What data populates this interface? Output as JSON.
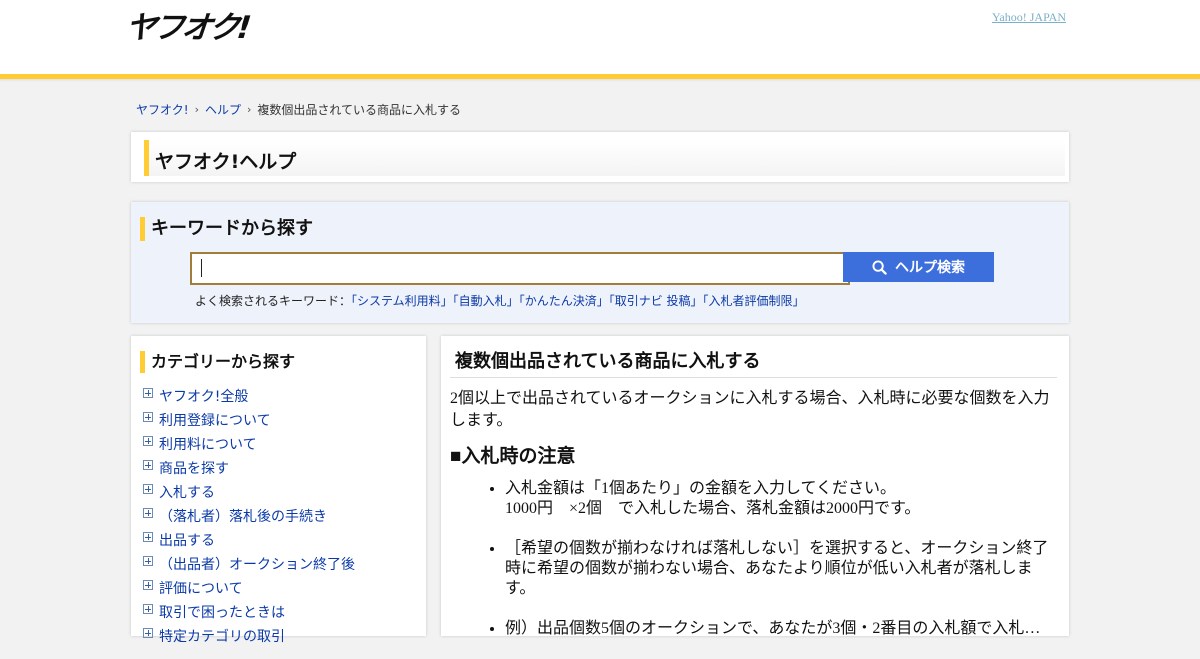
{
  "header": {
    "logo": "ヤフオク!",
    "yahoo_link": "Yahoo! JAPAN"
  },
  "breadcrumb": [
    "ヤフオク!",
    "ヘルプ",
    "複数個出品されている商品に入札する"
  ],
  "help_title": "ヤフオク!ヘルプ",
  "search": {
    "heading": "キーワードから探す",
    "input_value": "",
    "button_label": "ヘルプ検索",
    "popular_label": "よく検索されるキーワード：",
    "popular_keywords": [
      "「システム利用料」",
      "「自動入札」",
      "「かんたん決済」",
      "「取引ナビ 投稿」",
      "「入札者評価制限」"
    ]
  },
  "category": {
    "heading": "カテゴリーから探す",
    "items": [
      "ヤフオク!全般",
      "利用登録について",
      "利用料について",
      "商品を探す",
      "入札する",
      "（落札者）落札後の手続き",
      "出品する",
      "（出品者）オークション終了後",
      "評価について",
      "取引で困ったときは",
      "特定カテゴリの取引"
    ]
  },
  "article": {
    "title": "複数個出品されている商品に入札する",
    "intro": "2個以上で出品されているオークションに入札する場合、入札時に必要な個数を入力します。",
    "section_heading": "■入札時の注意",
    "notes": [
      {
        "line1": "入札金額は「1個あたり」の金額を入力してください。",
        "line2": "1000円　×2個　で入札した場合、落札金額は2000円です。"
      },
      {
        "line1": "［希望の個数が揃わなければ落札しない］を選択すると、オークション終了時に希望の個数が揃わない場合、あなたより順位が低い入札者が落札します。",
        "line2": ""
      },
      {
        "line1": "例）出品個数5個のオークションで、あなたが3個・2番目の入札額で入札…",
        "line2": ""
      }
    ]
  }
}
